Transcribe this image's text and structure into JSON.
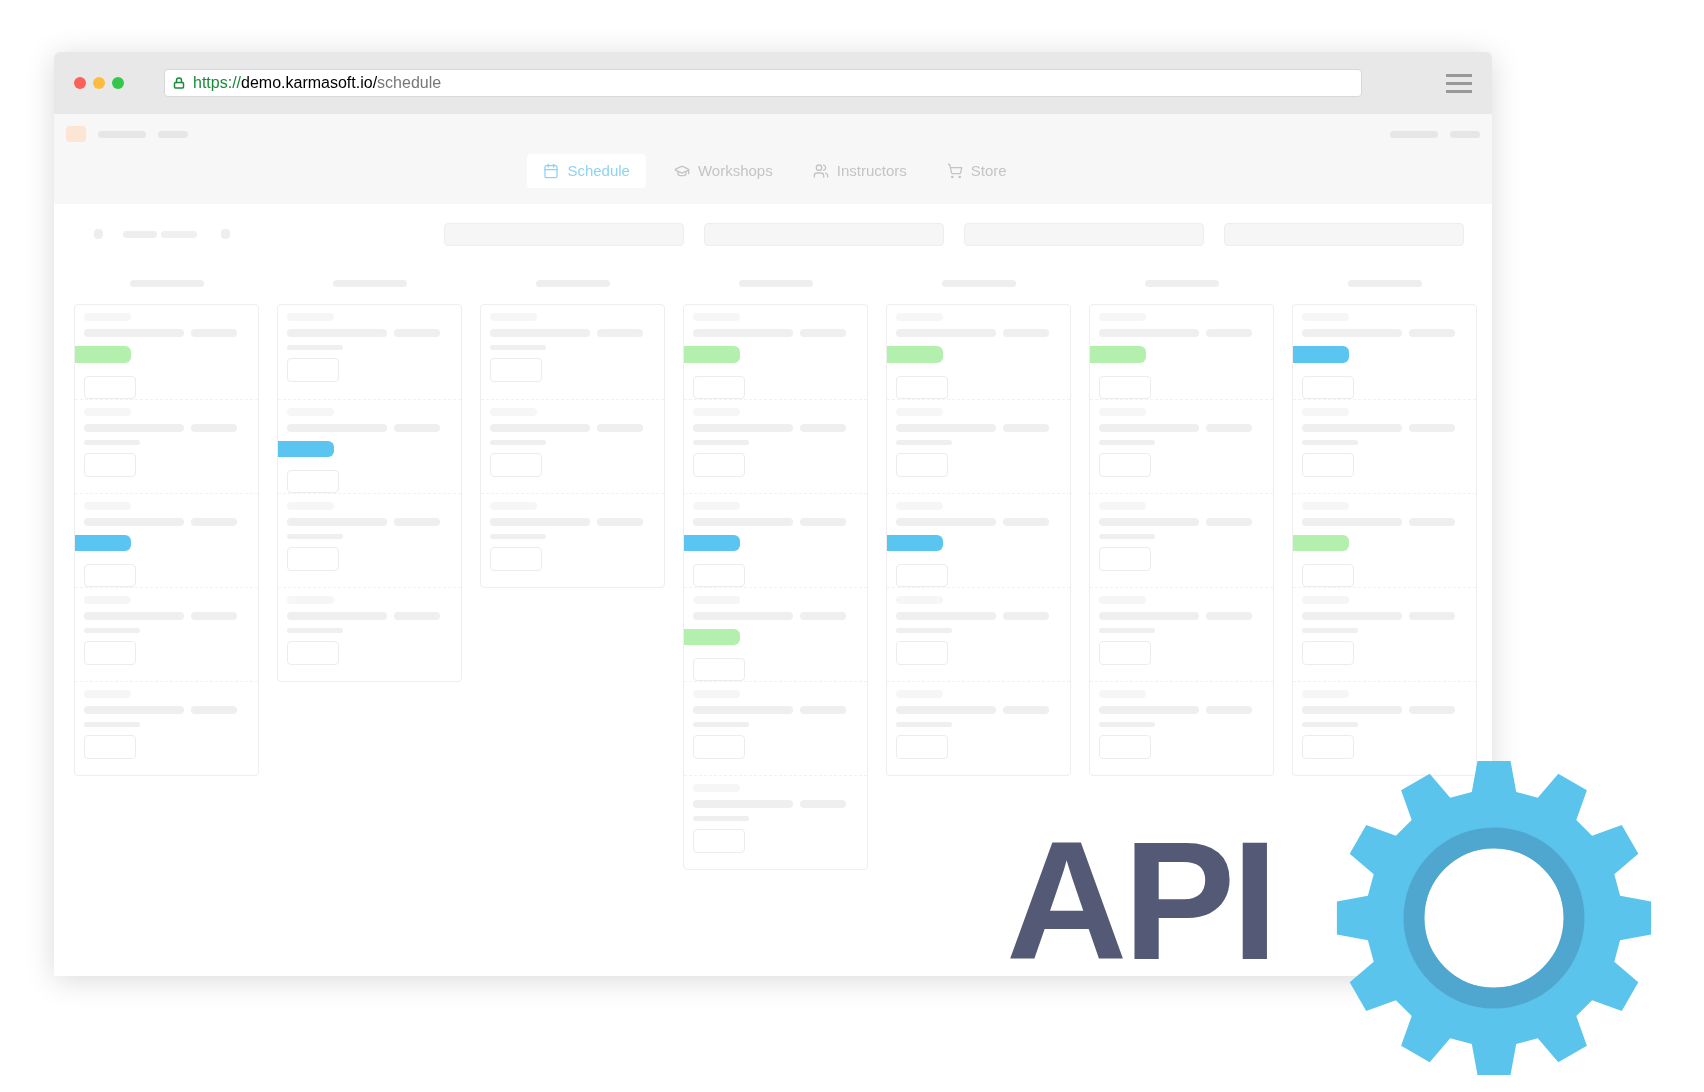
{
  "browser": {
    "url": {
      "scheme": "https://",
      "host": "demo.karmasoft.io/",
      "path": "schedule"
    }
  },
  "tabs": [
    {
      "label": "Schedule",
      "selected": true
    },
    {
      "label": "Workshops",
      "selected": false
    },
    {
      "label": "Instructors",
      "selected": false
    },
    {
      "label": "Store",
      "selected": false
    }
  ],
  "columns": [
    {
      "events": [
        {
          "kind": "tagged",
          "color": "#b3f0ad"
        },
        {
          "kind": "plain"
        },
        {
          "kind": "tagged",
          "color": "#5bc5f2"
        },
        {
          "kind": "plain"
        },
        {
          "kind": "plain"
        }
      ]
    },
    {
      "events": [
        {
          "kind": "plain"
        },
        {
          "kind": "tagged",
          "color": "#5bc5f2"
        },
        {
          "kind": "plain"
        },
        {
          "kind": "plain"
        }
      ]
    },
    {
      "events": [
        {
          "kind": "plain"
        },
        {
          "kind": "plain"
        },
        {
          "kind": "plain"
        }
      ]
    },
    {
      "events": [
        {
          "kind": "tagged",
          "color": "#b3f0ad"
        },
        {
          "kind": "plain"
        },
        {
          "kind": "tagged",
          "color": "#5bc5f2"
        },
        {
          "kind": "tagged",
          "color": "#b3f0ad"
        },
        {
          "kind": "plain"
        },
        {
          "kind": "plain"
        }
      ]
    },
    {
      "events": [
        {
          "kind": "tagged",
          "color": "#b3f0ad"
        },
        {
          "kind": "plain"
        },
        {
          "kind": "tagged",
          "color": "#5bc5f2"
        },
        {
          "kind": "plain"
        },
        {
          "kind": "plain"
        }
      ]
    },
    {
      "events": [
        {
          "kind": "tagged",
          "color": "#b3f0ad"
        },
        {
          "kind": "plain"
        },
        {
          "kind": "plain"
        },
        {
          "kind": "plain"
        },
        {
          "kind": "plain"
        }
      ]
    },
    {
      "events": [
        {
          "kind": "tagged",
          "color": "#5bc5f2"
        },
        {
          "kind": "plain"
        },
        {
          "kind": "tagged",
          "color": "#b3f0ad"
        },
        {
          "kind": "plain"
        },
        {
          "kind": "plain"
        }
      ]
    }
  ],
  "badge": {
    "text": "API"
  }
}
